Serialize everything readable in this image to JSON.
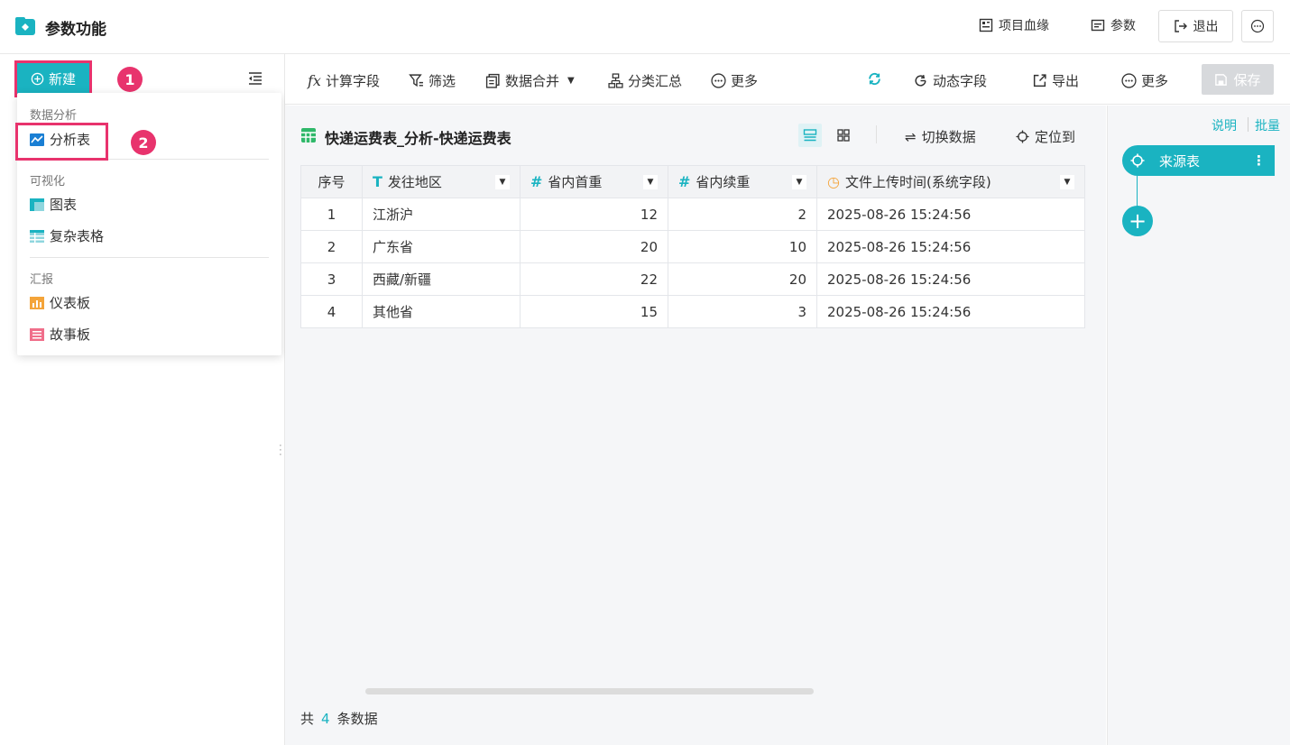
{
  "header": {
    "title": "参数功能",
    "lineage_label": "项目血缘",
    "params_label": "参数",
    "exit_label": "退出"
  },
  "sidebar": {
    "new_label": "新建",
    "step1": "1",
    "step2": "2",
    "menu": {
      "group_analysis": "数据分析",
      "item_analysis_table": "分析表",
      "group_visual": "可视化",
      "item_chart": "图表",
      "item_complex_table": "复杂表格",
      "group_report": "汇报",
      "item_dashboard": "仪表板",
      "item_storyboard": "故事板"
    }
  },
  "toolbar": {
    "calc_field": "计算字段",
    "filter": "筛选",
    "merge": "数据合并",
    "group_summary": "分类汇总",
    "more_left": "更多",
    "dynamic_field": "动态字段",
    "export": "导出",
    "more_right": "更多",
    "save": "保存"
  },
  "main": {
    "table_title": "快递运费表_分析-快递运费表",
    "switch_data": "切换数据",
    "locate": "定位到",
    "columns": [
      "序号",
      "发往地区",
      "省内首重",
      "省内续重",
      "文件上传时间(系统字段)"
    ],
    "rows": [
      [
        "1",
        "江浙沪",
        "12",
        "2",
        "2025-08-26 15:24:56"
      ],
      [
        "2",
        "广东省",
        "20",
        "10",
        "2025-08-26 15:24:56"
      ],
      [
        "3",
        "西藏/新疆",
        "22",
        "20",
        "2025-08-26 15:24:56"
      ],
      [
        "4",
        "其他省",
        "15",
        "3",
        "2025-08-26 15:24:56"
      ]
    ],
    "footer_prefix": "共",
    "footer_count": "4",
    "footer_suffix": "条数据"
  },
  "right_panel": {
    "explain": "说明",
    "batch": "批量",
    "source_node": "来源表"
  },
  "colors": {
    "accent": "#1ab3c1",
    "highlight": "#e8336d"
  }
}
